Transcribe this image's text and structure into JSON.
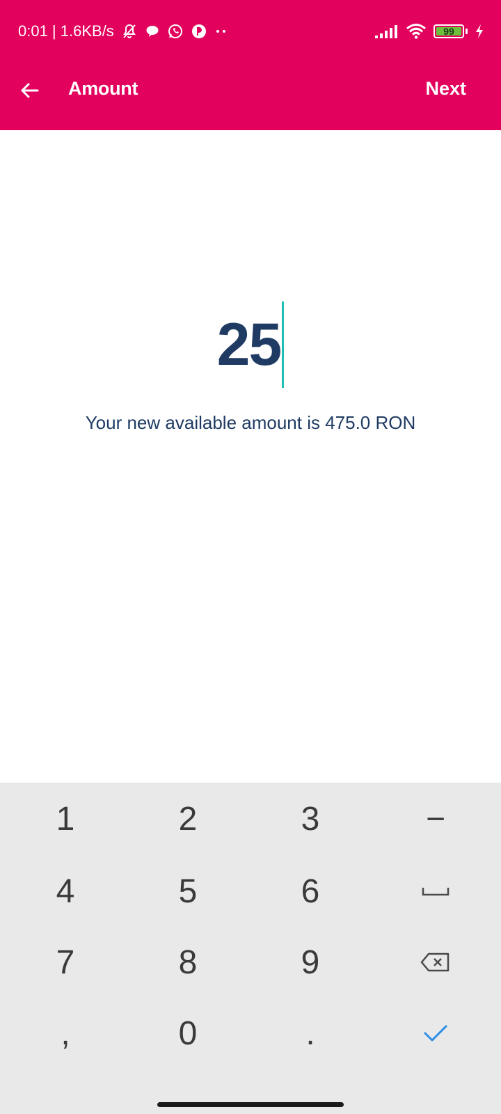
{
  "status_bar": {
    "time_speed": "0:01 | 1.6KB/s",
    "battery_level": "99",
    "icons": [
      "muted-bell-icon",
      "chat-bubble-icon",
      "whatsapp-icon",
      "app-notification-icon",
      "more-dots-icon",
      "signal-icon",
      "wifi-icon",
      "battery-icon",
      "charging-bolt-icon"
    ]
  },
  "app_bar": {
    "title": "Amount",
    "next_label": "Next",
    "background": "#e2015c"
  },
  "main": {
    "amount": "25",
    "available_text": "Your new available amount is 475.0 RON",
    "amount_color": "#1f3b63",
    "cursor_color": "#1cbfb0"
  },
  "keyboard": {
    "keys": {
      "k1": "1",
      "k2": "2",
      "k3": "3",
      "minus": "−",
      "k4": "4",
      "k5": "5",
      "k6": "6",
      "k7": "7",
      "k8": "8",
      "k9": "9",
      "comma": ",",
      "k0": "0",
      "dot": "."
    },
    "accent": "#2f8ee6"
  }
}
